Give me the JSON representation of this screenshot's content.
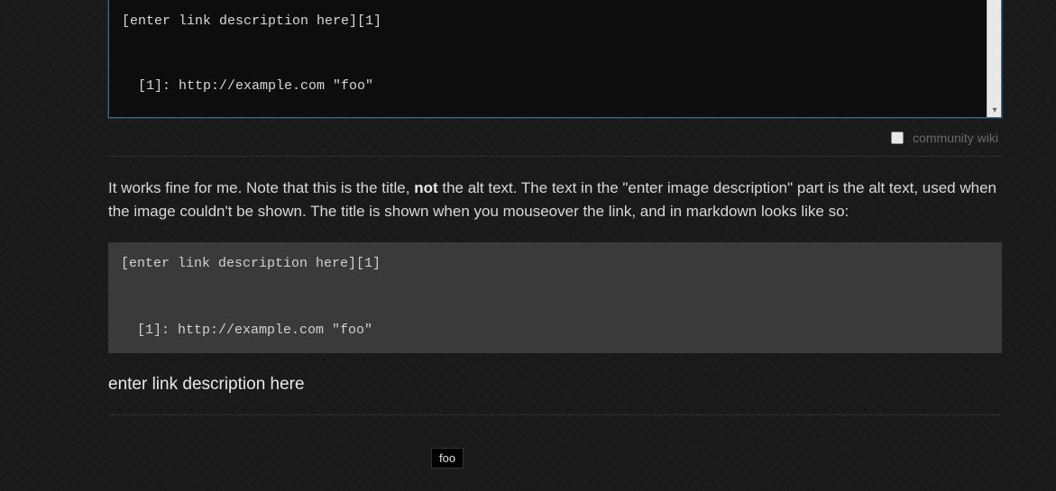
{
  "editor": {
    "content": "[enter link description here][1]\n\n\n  [1]: http://example.com \"foo\""
  },
  "wiki": {
    "label": "community wiki"
  },
  "answer": {
    "part1": "It works fine for me. Note that this is the title, ",
    "bold": "not",
    "part2": " the alt text. The text in the \"enter image description\" part is the alt text, used when the image couldn't be shown. The title is shown when you mouseover the link, and in markdown looks like so:"
  },
  "code_block": {
    "content": "[enter link description here][1]\n\n\n  [1]: http://example.com \"foo\""
  },
  "link_preview": {
    "text": "enter link description here",
    "tooltip": "foo"
  }
}
